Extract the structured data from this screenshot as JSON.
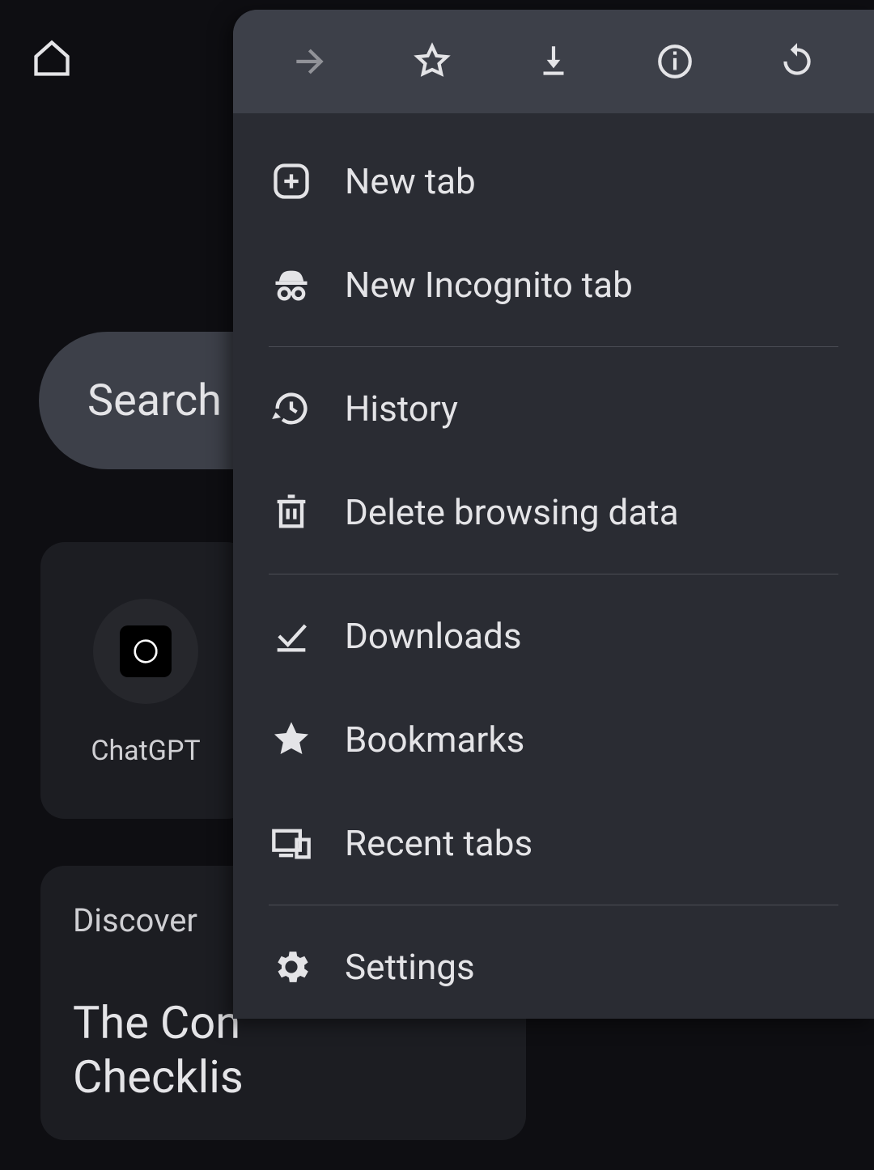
{
  "background": {
    "search_placeholder": "Search",
    "shortcut_label": "ChatGPT",
    "discover_heading": "Discover",
    "article_title": "The Con\nChecklis"
  },
  "menu": {
    "items": {
      "new_tab": "New tab",
      "new_incognito": "New Incognito tab",
      "history": "History",
      "delete_data": "Delete browsing data",
      "downloads": "Downloads",
      "bookmarks": "Bookmarks",
      "recent_tabs": "Recent tabs",
      "settings": "Settings"
    }
  }
}
